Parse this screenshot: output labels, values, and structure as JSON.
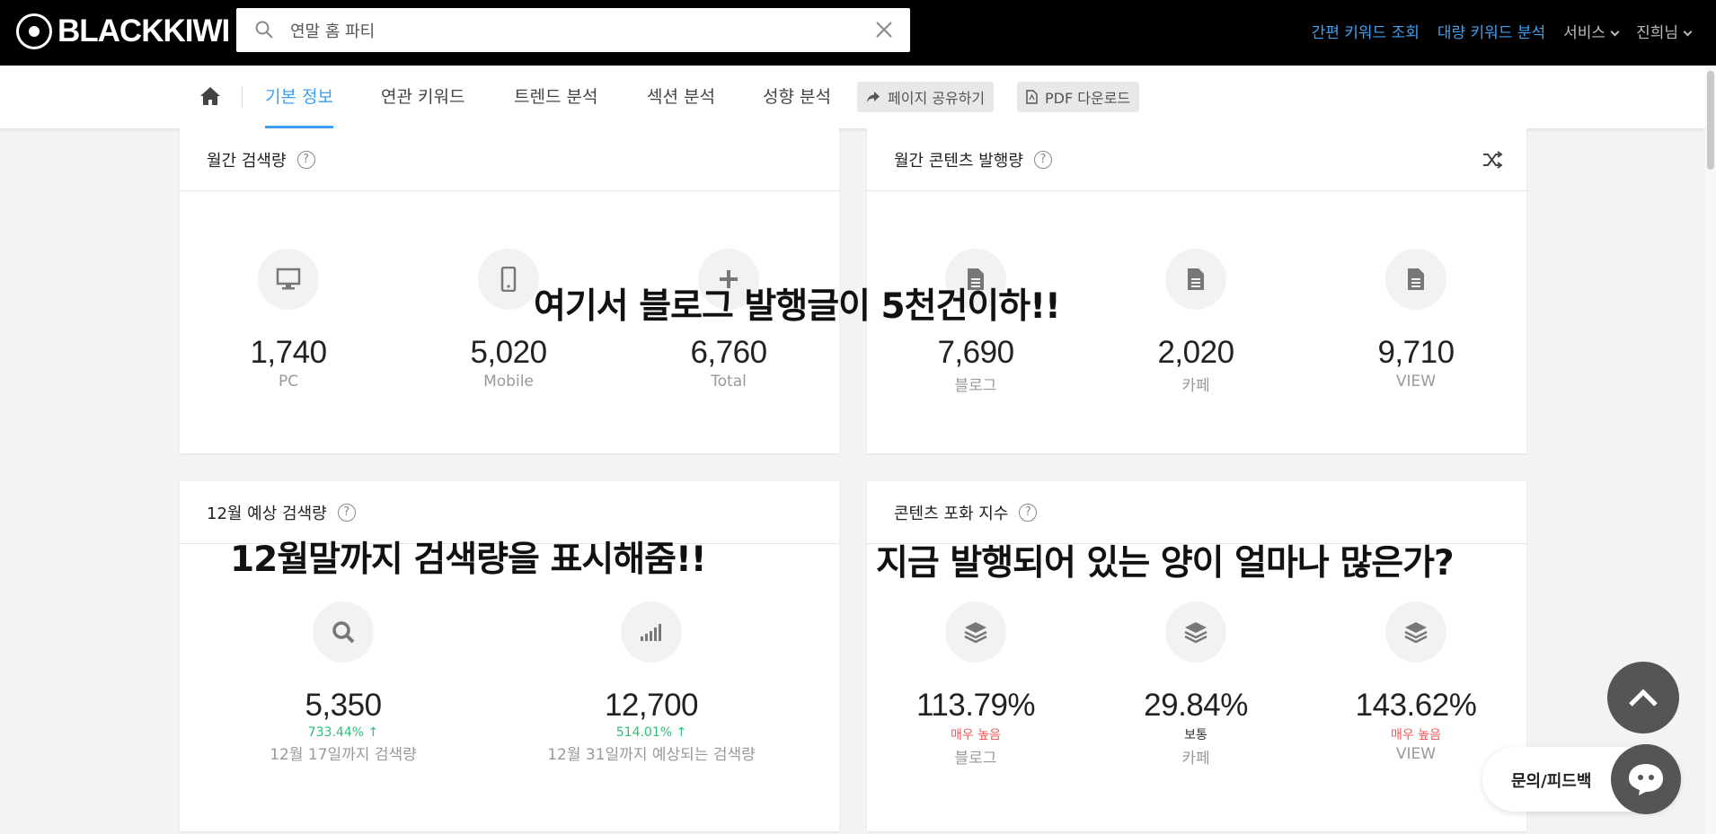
{
  "header": {
    "logo_text": "BLACKKIWI",
    "search_value": "연말 홈 파티",
    "links": {
      "simple_keyword": "간편 키워드 조회",
      "bulk_keyword": "대량 키워드 분석",
      "service": "서비스",
      "user": "진희님"
    }
  },
  "nav": {
    "tabs": [
      "기본 정보",
      "연관 키워드",
      "트렌드 분석",
      "섹션 분석",
      "성향 분석"
    ],
    "active_tab": "기본 정보",
    "share_label": "페이지 공유하기",
    "pdf_label": "PDF 다운로드"
  },
  "monthly_search": {
    "title": "월간 검색량",
    "stats": [
      {
        "value": "1,740",
        "label": "PC",
        "icon": "monitor-icon"
      },
      {
        "value": "5,020",
        "label": "Mobile",
        "icon": "mobile-icon"
      },
      {
        "value": "6,760",
        "label": "Total",
        "icon": "plus-icon"
      }
    ]
  },
  "monthly_content": {
    "title": "월간 콘텐츠 발행량",
    "stats": [
      {
        "value": "7,690",
        "label": "블로그",
        "icon": "document-icon"
      },
      {
        "value": "2,020",
        "label": "카페",
        "icon": "document-icon"
      },
      {
        "value": "9,710",
        "label": "VIEW",
        "icon": "document-icon"
      }
    ]
  },
  "december_forecast": {
    "title": "12월 예상 검색량",
    "stats": [
      {
        "value": "5,350",
        "change": "733.44%",
        "label": "12월 17일까지 검색량",
        "icon": "search-icon"
      },
      {
        "value": "12,700",
        "change": "514.01%",
        "label": "12월 31일까지 예상되는 검색량",
        "icon": "signal-icon"
      }
    ]
  },
  "saturation": {
    "title": "콘텐츠 포화 지수",
    "stats": [
      {
        "value": "113.79%",
        "level": "매우 높음",
        "label": "블로그",
        "icon": "layers-icon"
      },
      {
        "value": "29.84%",
        "level": "보통",
        "label": "카페",
        "icon": "layers-icon"
      },
      {
        "value": "143.62%",
        "level": "매우 높음",
        "label": "VIEW",
        "icon": "layers-icon"
      }
    ]
  },
  "annotations": {
    "content_note": "여기서 블로그 발행글이 5천건이하!!",
    "forecast_note": "12월말까지 검색량을 표시해줌!!",
    "saturation_note": "지금 발행되어 있는 양이 얼마나 많은가?"
  },
  "feedback": {
    "label": "문의/피드백"
  },
  "colors": {
    "accent": "#3fa0f0",
    "up_green": "#2bbf7a",
    "high_red": "#f05a5a"
  }
}
